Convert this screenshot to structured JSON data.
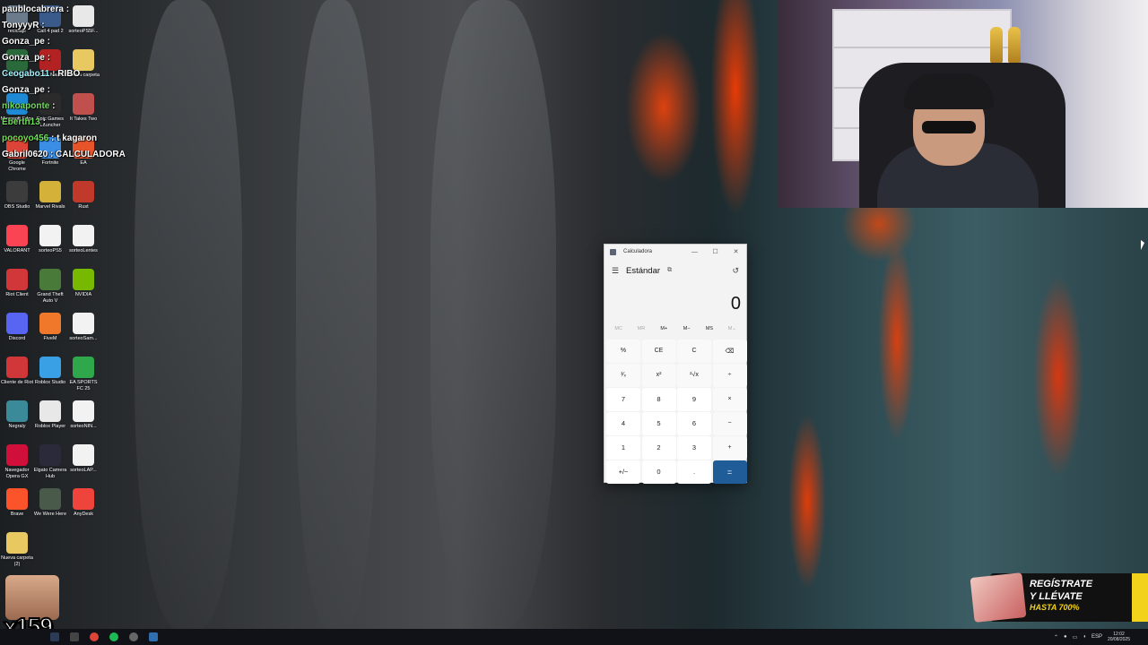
{
  "chat": [
    {
      "user": "paublocabrera",
      "text": "",
      "color": ""
    },
    {
      "user": "TonyyyR",
      "text": "",
      "color": ""
    },
    {
      "user": "Gonza_pe",
      "text": "",
      "color": ""
    },
    {
      "user": "Gonza_pe",
      "text": "",
      "color": ""
    },
    {
      "user": "Ceogabo11",
      "text": "RIBO",
      "color": "cyan"
    },
    {
      "user": "Gonza_pe",
      "text": "",
      "color": ""
    },
    {
      "user": "nikoaponte",
      "text": "",
      "color": "green"
    },
    {
      "user": "Eberth13",
      "text": "",
      "color": "green"
    },
    {
      "user": "pocoyo456",
      "text": "t kagaron",
      "color": "green"
    },
    {
      "user": "Gabril0620",
      "text": "CALCULADORA",
      "color": ""
    }
  ],
  "desktop_icons": [
    {
      "label": "reciclaje",
      "color": "#6b7b8c"
    },
    {
      "label": "Call 4 pad 2",
      "color": "#3a5a8c"
    },
    {
      "label": "sorteoPS5F...",
      "color": "#e8e8e8"
    },
    {
      "label": "FMMonitor",
      "color": "#2a6a3a"
    },
    {
      "label": "Ryzen Master",
      "color": "#b22222"
    },
    {
      "label": "Nueva carpeta",
      "color": "#e8c860"
    },
    {
      "label": "Microsoft Edge",
      "color": "#1e8ad6"
    },
    {
      "label": "Epic Games Launcher",
      "color": "#2b2b2b"
    },
    {
      "label": "It Takes Two",
      "color": "#c0504d"
    },
    {
      "label": "Google Chrome",
      "color": "#db4437"
    },
    {
      "label": "Fortnite",
      "color": "#3a8ee6"
    },
    {
      "label": "EA",
      "color": "#e8542a"
    },
    {
      "label": "OBS Studio",
      "color": "#3c3c3c"
    },
    {
      "label": "Marvel Rivals",
      "color": "#d4b23a"
    },
    {
      "label": "Rust",
      "color": "#c0392b"
    },
    {
      "label": "VALORANT",
      "color": "#fa4454"
    },
    {
      "label": "sorteoPS5",
      "color": "#f2f2f2"
    },
    {
      "label": "sorteoLentes",
      "color": "#f2f2f2"
    },
    {
      "label": "Riot Client",
      "color": "#d13639"
    },
    {
      "label": "Grand Theft Auto V",
      "color": "#4a7a3a"
    },
    {
      "label": "NVIDIA",
      "color": "#76b900"
    },
    {
      "label": "Discord",
      "color": "#5865f2"
    },
    {
      "label": "FiveM",
      "color": "#f0782a"
    },
    {
      "label": "sorteoSam...",
      "color": "#f2f2f2"
    },
    {
      "label": "Cliente de Riot",
      "color": "#d13639"
    },
    {
      "label": "Roblox Studio",
      "color": "#3aa0e6"
    },
    {
      "label": "EA SPORTS FC 25",
      "color": "#2ea84a"
    },
    {
      "label": "Negraly",
      "color": "#3a8a9a"
    },
    {
      "label": "Roblox Player",
      "color": "#e8e8e8"
    },
    {
      "label": "sorteoNIN...",
      "color": "#f2f2f2"
    },
    {
      "label": "Navegador Opera GX",
      "color": "#d0103a"
    },
    {
      "label": "Elgato Camera Hub",
      "color": "#2a2a3a"
    },
    {
      "label": "sorteoLAP...",
      "color": "#f2f2f2"
    },
    {
      "label": "Brave",
      "color": "#fb542b"
    },
    {
      "label": "We Were Here",
      "color": "#4a5a4a"
    },
    {
      "label": "AnyDesk",
      "color": "#ef443b"
    },
    {
      "label": "Nueva carpeta (2)",
      "color": "#e8c860"
    }
  ],
  "calculator": {
    "window_title": "Calculadora",
    "mode": "Estándar",
    "display": "0",
    "menu_icon": "hamburger-icon",
    "memory": [
      "MC",
      "MR",
      "M+",
      "M−",
      "MS",
      "M⌄"
    ],
    "keys": [
      "%",
      "CE",
      "C",
      "⌫",
      "¹⁄ₓ",
      "x²",
      "²√x",
      "÷",
      "7",
      "8",
      "9",
      "×",
      "4",
      "5",
      "6",
      "−",
      "1",
      "2",
      "3",
      "+",
      "+/−",
      "0",
      ".",
      "="
    ],
    "accent": "#1f5c98"
  },
  "ad": {
    "line1": "REGÍSTRATE",
    "line2": "Y LLÉVATE",
    "line3": "HASTA 700%"
  },
  "overlay": {
    "counter": "x159"
  },
  "taskbar": {
    "lang": "ESP",
    "time": "12:02",
    "date": "20/08/2025"
  }
}
